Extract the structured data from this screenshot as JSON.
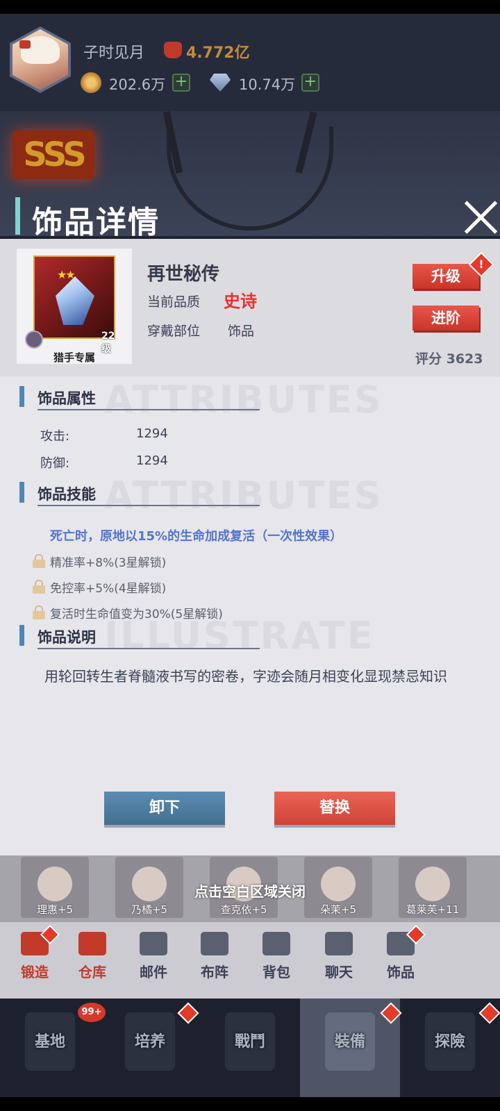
{
  "player": {
    "name": "子时见月",
    "power": "4.772亿",
    "gold": "202.6万",
    "gems": "10.74万",
    "plus_label": "+"
  },
  "modal": {
    "title": "饰品详情",
    "item": {
      "name": "再世秘传",
      "quality_label": "当前品质",
      "quality_value": "史诗",
      "slot_label": "穿戴部位",
      "slot_value": "饰品",
      "level": "22级",
      "tag": "猎手专属",
      "stars": "★★",
      "score": "评分 3623"
    },
    "upgrade_label": "升级",
    "advance_label": "进阶",
    "alert_mark": "!",
    "attributes": {
      "title": "饰品属性",
      "watermark": "ATTRIBUTES",
      "rows": [
        {
          "label": "攻击:",
          "value": "1294"
        },
        {
          "label": "防御:",
          "value": "1294"
        }
      ]
    },
    "skills": {
      "title": "饰品技能",
      "watermark": "ATTRIBUTES",
      "main": "死亡时，原地以15%的生命加成复活（一次性效果）",
      "locked": [
        "精准率+8%(3星解锁)",
        "免控率+5%(4星解锁)",
        "复活时生命值变为30%(5星解锁)"
      ]
    },
    "description": {
      "title": "饰品说明",
      "watermark": "ILLUSTRATE",
      "text": "用轮回转生者脊髓液书写的密卷，字迹会随月相变化显现禁忌知识"
    },
    "unequip_label": "卸下",
    "replace_label": "替换"
  },
  "close_hint": "点击空白区域关闭",
  "heroes": [
    {
      "label": "理惠+5"
    },
    {
      "label": "乃橘+5"
    },
    {
      "label": "查克依+5"
    },
    {
      "label": "朵茉+5"
    },
    {
      "label": "葛莱芙+11"
    }
  ],
  "menu": [
    {
      "label": "锻造",
      "icon": "anvil-icon"
    },
    {
      "label": "仓库",
      "icon": "warehouse-icon"
    },
    {
      "label": "邮件",
      "icon": "mail-icon"
    },
    {
      "label": "布阵",
      "icon": "flag-icon"
    },
    {
      "label": "背包",
      "icon": "backpack-icon"
    },
    {
      "label": "聊天",
      "icon": "chat-icon"
    },
    {
      "label": "饰品",
      "icon": "accessory-icon"
    }
  ],
  "tabs": [
    {
      "label": "基地",
      "badge": "99+"
    },
    {
      "label": "培养"
    },
    {
      "label": "戰鬥"
    },
    {
      "label": "裝備"
    },
    {
      "label": "探險"
    }
  ],
  "colors": {
    "accent_red": "#e8322a",
    "skill_blue": "#5275c9",
    "title_bar": "#7fd3d0"
  }
}
